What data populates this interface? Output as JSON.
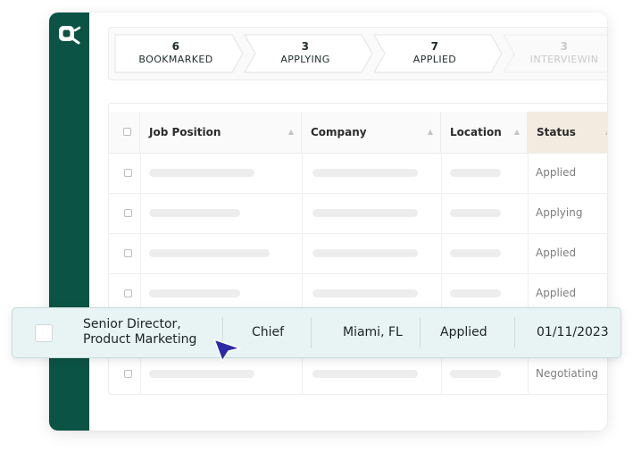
{
  "pipeline": {
    "steps": [
      {
        "count": "6",
        "label": "BOOKMARKED"
      },
      {
        "count": "3",
        "label": "APPLYING"
      },
      {
        "count": "7",
        "label": "APPLIED"
      },
      {
        "count": "3",
        "label": "INTERVIEWIN"
      }
    ]
  },
  "table": {
    "headers": {
      "job_position": "Job Position",
      "company": "Company",
      "location": "Location",
      "status": "Status"
    },
    "rows": [
      {
        "status": "Applied"
      },
      {
        "status": "Applying"
      },
      {
        "status": "Applied"
      },
      {
        "status": "Applied"
      },
      {
        "status": ""
      },
      {
        "status": "Negotiating"
      }
    ]
  },
  "highlighted_row": {
    "job_position_line1": "Senior Director,",
    "job_position_line2": "Product Marketing",
    "company": "Chief",
    "location": "Miami, FL",
    "status": "Applied",
    "date": "01/11/2023"
  },
  "colors": {
    "sidebar": "#0b5345",
    "status_header": "#f4ebe0",
    "highlight_row": "#e8f3f3",
    "cursor": "#2d2aa8"
  },
  "icons": {
    "logo": "app-logo-icon",
    "cursor": "mouse-pointer-icon",
    "sort": "sort-arrow-icon"
  }
}
